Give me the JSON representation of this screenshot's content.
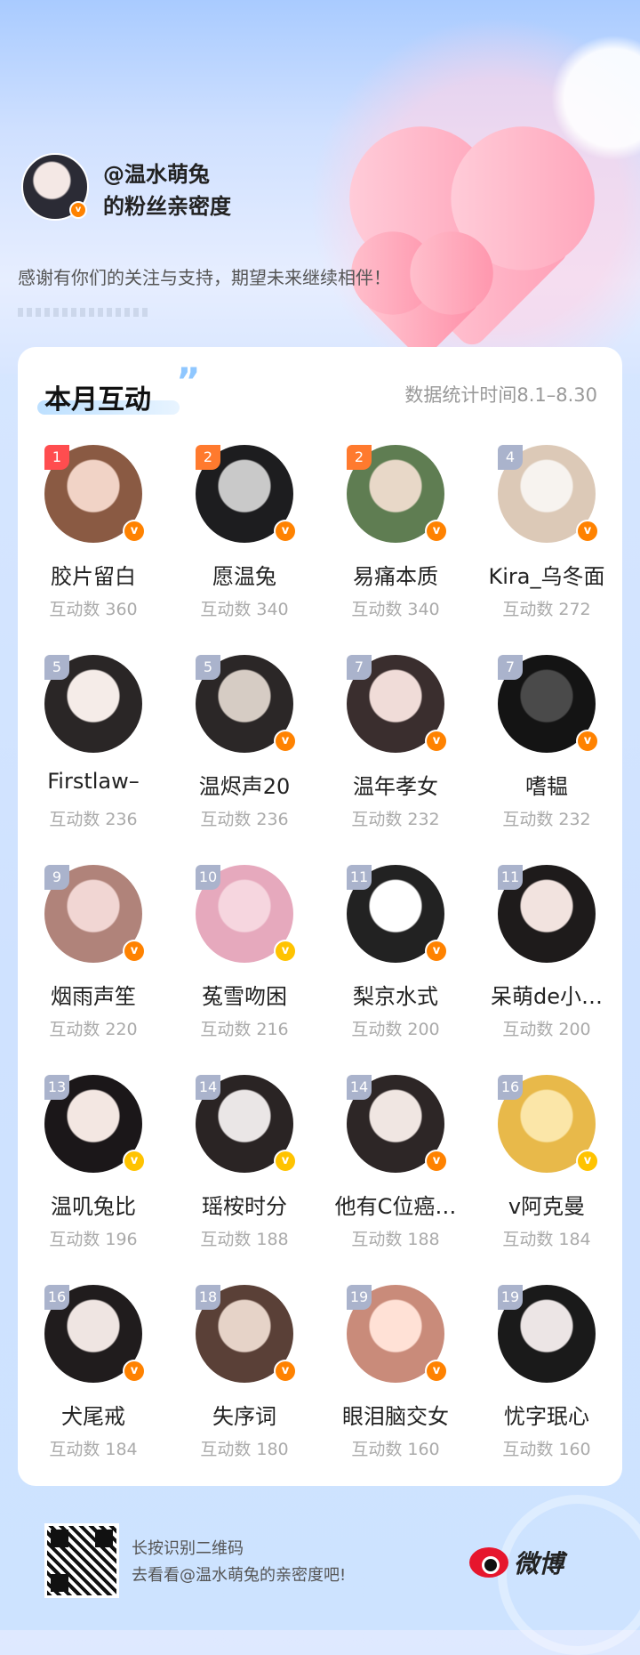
{
  "header": {
    "username_line": "@温水萌兔",
    "subtitle_line": "的粉丝亲密度",
    "thanks": "感谢有你们的关注与支持，期望未来继续相伴！"
  },
  "card": {
    "title": "本月互动",
    "stat_time": "数据统计时间8.1–8.30"
  },
  "fans": [
    {
      "rank": "1",
      "name": "胶片留白",
      "count": "互动数 360",
      "badge": "orange",
      "rank_color": "#ff4d4f",
      "avatar": [
        "#f1d3c6",
        "#8a5a43"
      ]
    },
    {
      "rank": "2",
      "name": "愿温兔",
      "count": "互动数 340",
      "badge": "orange",
      "rank_color": "#ff7a2e",
      "avatar": [
        "#c9c9c9",
        "#1d1d1f"
      ]
    },
    {
      "rank": "2",
      "name": "易痛本质",
      "count": "互动数 340",
      "badge": "orange",
      "rank_color": "#ff7a2e",
      "avatar": [
        "#e8d8c8",
        "#5f7d52"
      ]
    },
    {
      "rank": "4",
      "name": "Kira_乌冬面",
      "count": "互动数 272",
      "badge": "orange",
      "rank_color": "#aab3cc",
      "avatar": [
        "#f7f3ef",
        "#dcc9b7"
      ]
    },
    {
      "rank": "5",
      "name": "Firstlaw–",
      "count": "互动数 236",
      "badge": "",
      "rank_color": "#aab3cc",
      "avatar": [
        "#f5ece8",
        "#2a2626"
      ]
    },
    {
      "rank": "5",
      "name": "温烬声20",
      "count": "互动数 236",
      "badge": "orange",
      "rank_color": "#aab3cc",
      "avatar": [
        "#d6ccc4",
        "#2b2727"
      ]
    },
    {
      "rank": "7",
      "name": "温年孝女",
      "count": "互动数 232",
      "badge": "orange",
      "rank_color": "#aab3cc",
      "avatar": [
        "#f0dcd8",
        "#3a2e2e"
      ]
    },
    {
      "rank": "7",
      "name": "嗜韫",
      "count": "互动数 232",
      "badge": "orange",
      "rank_color": "#aab3cc",
      "avatar": [
        "#4a4a4a",
        "#141414"
      ]
    },
    {
      "rank": "9",
      "name": "烟雨声笙",
      "count": "互动数 220",
      "badge": "orange",
      "rank_color": "#aab3cc",
      "avatar": [
        "#f1d6d3",
        "#b0837a"
      ]
    },
    {
      "rank": "10",
      "name": "菟雪吻困",
      "count": "互动数 216",
      "badge": "gold",
      "rank_color": "#aab3cc",
      "avatar": [
        "#f6d6df",
        "#e6a9bd"
      ]
    },
    {
      "rank": "11",
      "name": "梨京水式",
      "count": "互动数 200",
      "badge": "orange",
      "rank_color": "#aab3cc",
      "avatar": [
        "#ffffff",
        "#222222"
      ]
    },
    {
      "rank": "11",
      "name": "呆萌de小…",
      "count": "互动数 200",
      "badge": "",
      "rank_color": "#aab3cc",
      "avatar": [
        "#f2e3df",
        "#1e1b1b"
      ]
    },
    {
      "rank": "13",
      "name": "温叽兔比",
      "count": "互动数 196",
      "badge": "gold",
      "rank_color": "#aab3cc",
      "avatar": [
        "#f3e7e2",
        "#1b1719"
      ]
    },
    {
      "rank": "14",
      "name": "瑶桉时分",
      "count": "互动数 188",
      "badge": "gold",
      "rank_color": "#aab3cc",
      "avatar": [
        "#eae6e6",
        "#2a2424"
      ]
    },
    {
      "rank": "14",
      "name": "他有C位癌…",
      "count": "互动数 188",
      "badge": "orange",
      "rank_color": "#aab3cc",
      "avatar": [
        "#f0e6e2",
        "#2d2626"
      ]
    },
    {
      "rank": "16",
      "name": "v阿克曼",
      "count": "互动数 184",
      "badge": "gold",
      "rank_color": "#aab3cc",
      "avatar": [
        "#fbe6a8",
        "#e8b94a"
      ]
    },
    {
      "rank": "16",
      "name": "犬尾戒",
      "count": "互动数 184",
      "badge": "orange",
      "rank_color": "#aab3cc",
      "avatar": [
        "#efe5e2",
        "#201c1d"
      ]
    },
    {
      "rank": "18",
      "name": "失序词",
      "count": "互动数 180",
      "badge": "orange",
      "rank_color": "#aab3cc",
      "avatar": [
        "#e6d3c8",
        "#5a4037"
      ]
    },
    {
      "rank": "19",
      "name": "眼泪脑交女",
      "count": "互动数 160",
      "badge": "orange",
      "rank_color": "#aab3cc",
      "avatar": [
        "#ffe1d6",
        "#c98b7a"
      ]
    },
    {
      "rank": "19",
      "name": "忧字珉心",
      "count": "互动数 160",
      "badge": "",
      "rank_color": "#aab3cc",
      "avatar": [
        "#ece5e5",
        "#1a1a1a"
      ]
    }
  ],
  "footer": {
    "line1": "长按识别二维码",
    "line2": "去看看@温水萌兔的亲密度吧!",
    "brand": "微博"
  },
  "colors": {
    "badge_orange": "#ff8200",
    "badge_gold": "#ffc300",
    "weibo_red": "#e6162d"
  }
}
